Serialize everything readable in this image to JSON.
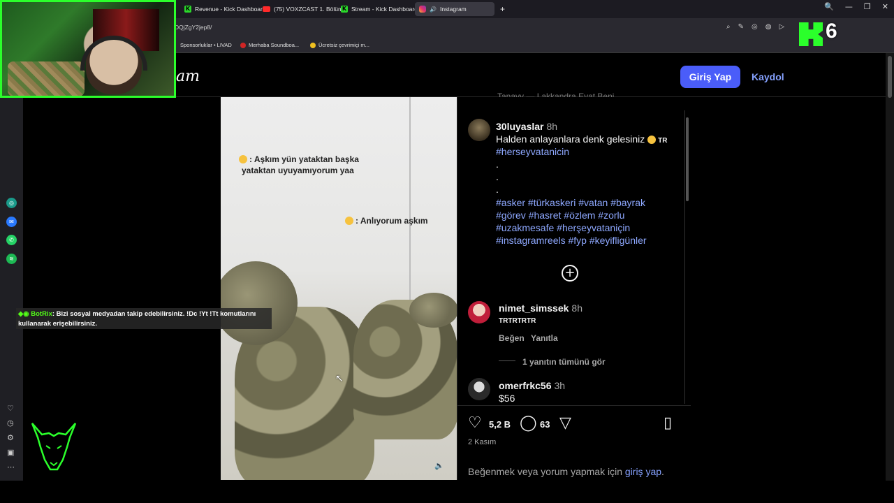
{
  "browser": {
    "tabs": [
      {
        "label": "Revenue - Kick Dashboard",
        "icon": "kick-icon"
      },
      {
        "label": "(75) VOXZCAST 1. Bölüm",
        "icon": "youtube-icon"
      },
      {
        "label": "Stream - Kick Dashboard",
        "icon": "kick-icon"
      },
      {
        "label": "Instagram",
        "icon": "instagram-icon",
        "active": true
      }
    ],
    "new_tab": "+",
    "url": "DQjZgY2jep8/",
    "bookmarks": [
      {
        "label": "Sponsorluklar • LIVAD"
      },
      {
        "label": "Merhaba Soundboa..."
      },
      {
        "label": "Ücretsiz çevrimiçi m..."
      }
    ],
    "window_controls": [
      "🔍",
      "—",
      "❐",
      "✕"
    ]
  },
  "instagram": {
    "logo_fragment": "am",
    "login_button": "Giriş Yap",
    "signup_link": "Kaydol",
    "video": {
      "overlay_line1": ": Aşkım yün yataktan başka",
      "overlay_line2": "yataktan uyuyamıyorum yaa",
      "overlay_reply": ": Anlıyorum aşkım"
    },
    "post": {
      "top_cut_text": "Tanayy — Lakkandra Eyat Beni",
      "author": "30luyaslar",
      "author_time": "8h",
      "caption": "Halden anlayanlara denk gelesiniz",
      "caption_suffix": "TR",
      "caption_tag1": "#herseyvatanicin",
      "dots": [
        ".",
        ".",
        "."
      ],
      "hashtags": "#asker #türkaskeri #vatan #bayrak #görev #hasret #özlem #zorlu #uzakmesafe #herşeyvataniçin #instagramreels #fyp #keyifligünler"
    },
    "comments": [
      {
        "user": "nimet_simssek",
        "time": "8h",
        "text": "TRTRTRTR",
        "like": "Beğen",
        "reply": "Yanıtla",
        "view_replies": "1 yanıtın tümünü gör"
      },
      {
        "user": "omerfrkc56",
        "time": "3h",
        "text": "$56"
      }
    ],
    "actions": {
      "likes": "5,2 B",
      "comments": "63"
    },
    "date": "2 Kasım",
    "login_prompt_prefix": "Beğenmek veya yorum yapmak için",
    "login_prompt_link": "giriş yap",
    "login_prompt_suffix": "."
  },
  "stream_overlay": {
    "kick_count": "6",
    "bot_name": "BotRix",
    "bot_message": ": Bizi sosyal medyadan takip edebilirsiniz. !Dc !Yt !Tt komutlarını kullanarak erişebilirsiniz."
  },
  "colors": {
    "accent": "#4a5df9",
    "link": "#85a1ff",
    "kick_green": "#2bff2b"
  }
}
